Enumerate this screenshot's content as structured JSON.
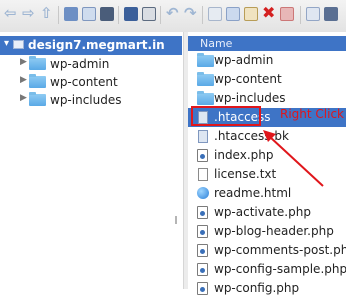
{
  "toolbar": {
    "buttons": [
      {
        "name": "back-icon"
      },
      {
        "name": "forward-icon"
      },
      {
        "name": "up-icon"
      },
      {
        "name": "new-folder-icon"
      },
      {
        "name": "new-file-icon"
      },
      {
        "name": "save-icon"
      },
      {
        "name": "cut-icon"
      },
      {
        "name": "paste-icon"
      },
      {
        "name": "undo-icon"
      },
      {
        "name": "redo-icon"
      },
      {
        "name": "copy-icon"
      },
      {
        "name": "copy-to-icon"
      },
      {
        "name": "delete-icon"
      },
      {
        "name": "rename-icon"
      },
      {
        "name": "properties-icon"
      }
    ]
  },
  "tree": {
    "root": "design7.megmart.in",
    "items": [
      "wp-admin",
      "wp-content",
      "wp-includes"
    ]
  },
  "list": {
    "header": "Name",
    "rows": [
      {
        "name": "wp-admin",
        "icon": "folder-icon"
      },
      {
        "name": "wp-content",
        "icon": "folder-icon"
      },
      {
        "name": "wp-includes",
        "icon": "folder-icon"
      },
      {
        "name": ".htaccess",
        "icon": "file-icon",
        "selected": true
      },
      {
        "name": ".htaccess.bk",
        "icon": "file-icon"
      },
      {
        "name": "index.php",
        "icon": "php-file-icon"
      },
      {
        "name": "license.txt",
        "icon": "text-file-icon"
      },
      {
        "name": "readme.html",
        "icon": "html-file-icon"
      },
      {
        "name": "wp-activate.php",
        "icon": "php-file-icon"
      },
      {
        "name": "wp-blog-header.php",
        "icon": "php-file-icon"
      },
      {
        "name": "wp-comments-post.php",
        "icon": "php-file-icon"
      },
      {
        "name": "wp-config-sample.php",
        "icon": "php-file-icon"
      },
      {
        "name": "wp-config.php",
        "icon": "php-file-icon"
      }
    ]
  },
  "annotation": {
    "text": "Right Click",
    "color": "#e0161b"
  },
  "colors": {
    "selection": "#3e74c6",
    "folder": "#5aa9e6"
  }
}
